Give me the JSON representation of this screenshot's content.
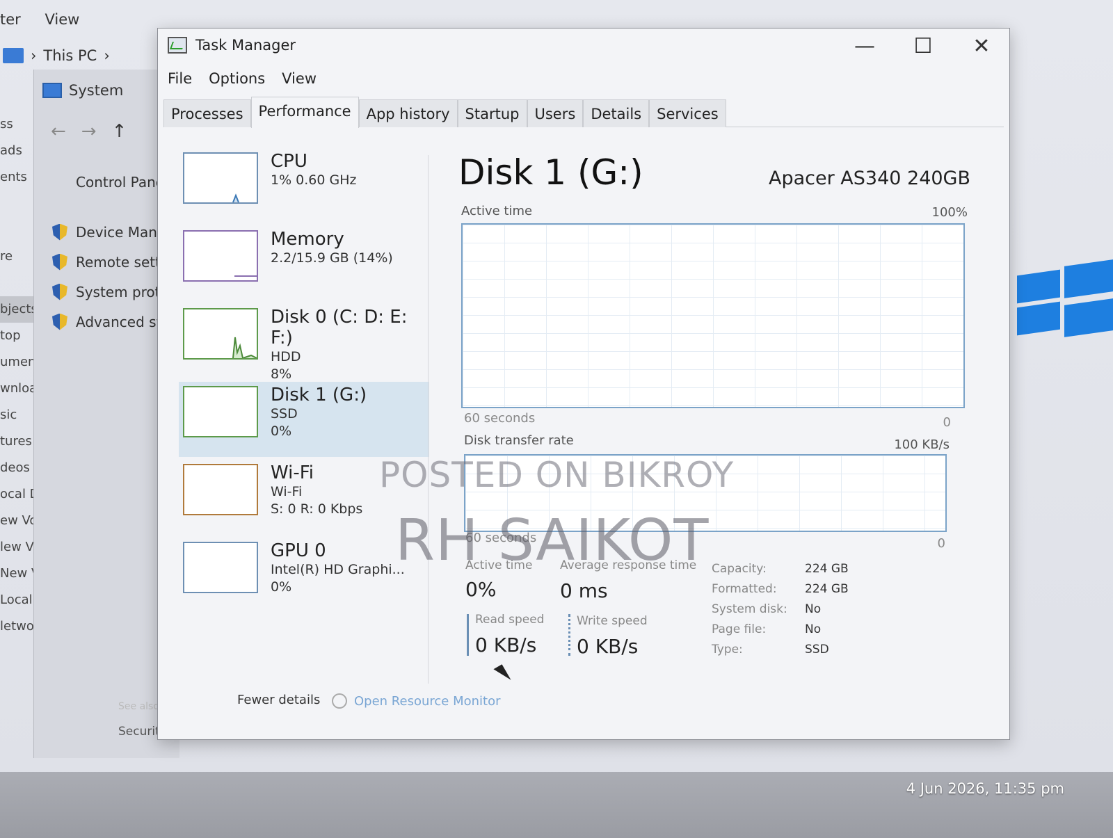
{
  "explorer": {
    "menu": [
      "ter",
      "View"
    ],
    "address": [
      "This PC"
    ],
    "system_label": "System",
    "control_panel": "Control Panel",
    "links": [
      "Device Manag",
      "Remote settin",
      "System protec",
      "Advanced sys"
    ],
    "sidebar": [
      "ss",
      "ads",
      "ents",
      "",
      "",
      "re",
      "",
      "bjects",
      "top",
      "uments",
      "wnloads",
      "sic",
      "tures",
      "deos",
      "ocal Disk (C:)",
      "ew Volume (I",
      "lew Volume (E",
      "New Volume (F",
      "Local Disk (G:)",
      "letwork"
    ],
    "see_also": "See also",
    "security": "Security and Maintenance"
  },
  "task_manager": {
    "title": "Task Manager",
    "controls": {
      "minimize": "—",
      "maximize": "☐",
      "close": "✕"
    },
    "menu": [
      "File",
      "Options",
      "View"
    ],
    "tabs": [
      "Processes",
      "Performance",
      "App history",
      "Startup",
      "Users",
      "Details",
      "Services"
    ],
    "active_tab": "Performance",
    "resources": [
      {
        "name": "CPU",
        "lines": [
          "1% 0.60 GHz"
        ]
      },
      {
        "name": "Memory",
        "lines": [
          "2.2/15.9 GB (14%)"
        ]
      },
      {
        "name": "Disk 0 (C: D: E: F:)",
        "lines": [
          "HDD",
          "8%"
        ]
      },
      {
        "name": "Disk 1 (G:)",
        "lines": [
          "SSD",
          "0%"
        ]
      },
      {
        "name": "Wi-Fi",
        "lines": [
          "Wi-Fi",
          "S: 0 R: 0 Kbps"
        ]
      },
      {
        "name": "GPU 0",
        "lines": [
          "Intel(R) HD Graphi...",
          "0%"
        ]
      }
    ],
    "selected_resource": "Disk 1 (G:)",
    "detail": {
      "title": "Disk 1 (G:)",
      "model": "Apacer AS340 240GB",
      "active_time_label": "Active time",
      "active_time_max": "100%",
      "active_time_span": "60 seconds",
      "active_time_min": "0",
      "transfer_label": "Disk transfer rate",
      "transfer_max": "100 KB/s",
      "transfer_span": "60 seconds",
      "transfer_min": "0",
      "stats": {
        "active_time_label": "Active time",
        "active_time_value": "0%",
        "response_label": "Average response time",
        "response_value": "0 ms",
        "read_label": "Read speed",
        "read_value": "0 KB/s",
        "write_label": "Write speed",
        "write_value": "0 KB/s"
      },
      "properties": [
        {
          "key": "Capacity:",
          "value": "224 GB"
        },
        {
          "key": "Formatted:",
          "value": "224 GB"
        },
        {
          "key": "System disk:",
          "value": "No"
        },
        {
          "key": "Page file:",
          "value": "No"
        },
        {
          "key": "Type:",
          "value": "SSD"
        }
      ]
    },
    "fewer_details": "Fewer details",
    "open_resource_monitor": "Open Resource Monitor"
  },
  "watermark": {
    "line1": "POSTED ON BIKROY",
    "line2": "RH SAIKOT"
  },
  "timestamp": "4 Jun 2026, 11:35 pm",
  "colors": {
    "graph_border": "#7ba3c8",
    "selected_bg": "#d6e4ef",
    "windows_blue": "#1e7fe0"
  }
}
